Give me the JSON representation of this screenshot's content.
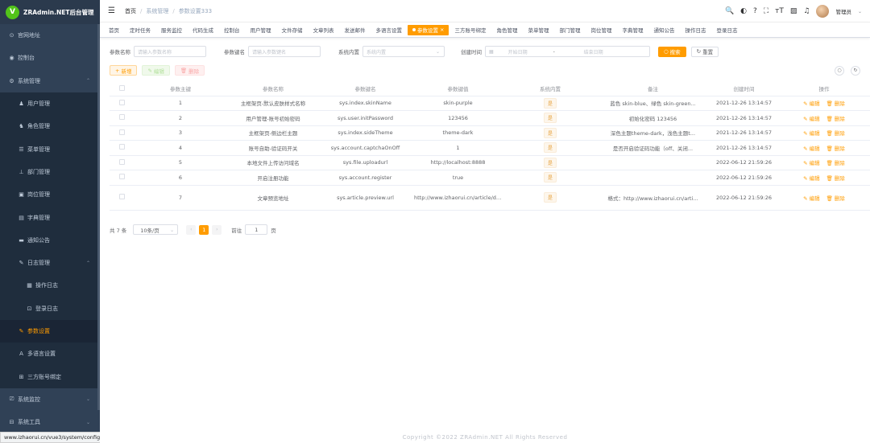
{
  "app": {
    "title": "ZRAdmin.NET后台管理",
    "logo_letter": "V"
  },
  "sidebar": {
    "items": [
      {
        "label": "官网地址",
        "icon": "link-icon",
        "glyph": "⊙",
        "level": 0
      },
      {
        "label": "控制台",
        "icon": "dashboard-icon",
        "glyph": "◉",
        "level": 0
      },
      {
        "label": "系统管理",
        "icon": "gear-icon",
        "glyph": "⚙",
        "level": 0,
        "arrow": "⌃"
      },
      {
        "label": "用户管理",
        "icon": "user-icon",
        "glyph": "♟",
        "level": 1
      },
      {
        "label": "角色管理",
        "icon": "peoples-icon",
        "glyph": "♞",
        "level": 1
      },
      {
        "label": "菜单管理",
        "icon": "menu-tree-icon",
        "glyph": "☰",
        "level": 1
      },
      {
        "label": "部门管理",
        "icon": "tree-icon",
        "glyph": "⊥",
        "level": 1
      },
      {
        "label": "岗位管理",
        "icon": "post-icon",
        "glyph": "▣",
        "level": 1
      },
      {
        "label": "字典管理",
        "icon": "dict-icon",
        "glyph": "▤",
        "level": 1
      },
      {
        "label": "通知公告",
        "icon": "message-icon",
        "glyph": "▬",
        "level": 1
      },
      {
        "label": "日志管理",
        "icon": "log-icon",
        "glyph": "✎",
        "level": 1,
        "arrow": "⌃"
      },
      {
        "label": "操作日志",
        "icon": "form-icon",
        "glyph": "▦",
        "level": 2
      },
      {
        "label": "登录日志",
        "icon": "logininfor-icon",
        "glyph": "⊡",
        "level": 2
      },
      {
        "label": "参数设置",
        "icon": "edit-icon",
        "glyph": "✎",
        "level": 1,
        "active": true
      },
      {
        "label": "多语言设置",
        "icon": "language-icon",
        "glyph": "A",
        "level": 1
      },
      {
        "label": "三方账号绑定",
        "icon": "bind-icon",
        "glyph": "⊞",
        "level": 1
      },
      {
        "label": "系统监控",
        "icon": "monitor-icon",
        "glyph": "⎚",
        "level": 0,
        "arrow": "⌄"
      },
      {
        "label": "系统工具",
        "icon": "tool-icon",
        "glyph": "⊟",
        "level": 0,
        "arrow": "⌄"
      }
    ]
  },
  "status_url": "www.izhaorui.cn/vue3/system/config",
  "breadcrumb": {
    "home": "首页",
    "parent": "系统管理",
    "current": "参数设置333"
  },
  "header": {
    "user_name": "管理员",
    "icons": [
      "search-icon",
      "github-icon",
      "question-icon",
      "fullscreen-icon",
      "font-size-icon",
      "language-icon",
      "bell-icon"
    ],
    "glyphs": [
      "🔍",
      "◐",
      "?",
      "⛶",
      "ᴛT",
      "▨",
      "♫"
    ]
  },
  "tags": [
    "首页",
    "定时任务",
    "服务监控",
    "代码生成",
    "控制台",
    "用户管理",
    "文件存储",
    "文章列表",
    "发送邮件",
    "多语言设置",
    "参数设置",
    "三方账号绑定",
    "角色管理",
    "菜单管理",
    "部门管理",
    "岗位管理",
    "字典管理",
    "通知公告",
    "操作日志",
    "登录日志"
  ],
  "active_tag": "参数设置",
  "search": {
    "name_label": "参数名称",
    "name_placeholder": "请输入参数名称",
    "key_label": "参数键名",
    "key_placeholder": "请输入参数键名",
    "builtin_label": "系统内置",
    "builtin_placeholder": "系统内置",
    "time_label": "创建时间",
    "start_placeholder": "开始日期",
    "range_sep": "-",
    "end_placeholder": "结束日期",
    "search_btn": "搜索",
    "reset_btn": "重置"
  },
  "toolbar": {
    "add": "新增",
    "edit": "编辑",
    "delete": "删除"
  },
  "table": {
    "columns": [
      "参数主键",
      "参数名称",
      "参数键名",
      "参数键值",
      "系统内置",
      "备注",
      "创建时间",
      "操作"
    ],
    "rows": [
      {
        "id": "1",
        "name": "主框架页-默认皮肤样式名称",
        "key": "sys.index.skinName",
        "value": "skin-purple",
        "builtin": "是",
        "remark": "蓝色 skin-blue、绿色 skin-green...",
        "time": "2021-12-26 13:14:57"
      },
      {
        "id": "2",
        "name": "用户管理-账号初始密码",
        "key": "sys.user.initPassword",
        "value": "123456",
        "builtin": "是",
        "remark": "初始化密码 123456",
        "time": "2021-12-26 13:14:57"
      },
      {
        "id": "3",
        "name": "主框架页-侧边栏主题",
        "key": "sys.index.sideTheme",
        "value": "theme-dark",
        "builtin": "是",
        "remark": "深色主题theme-dark，浅色主题t...",
        "time": "2021-12-26 13:14:57"
      },
      {
        "id": "4",
        "name": "账号自助-验证码开关",
        "key": "sys.account.captchaOnOff",
        "value": "1",
        "builtin": "是",
        "remark": "是否开启验证码功能（off、关闭...",
        "time": "2021-12-26 13:14:57"
      },
      {
        "id": "5",
        "name": "本地文件上传访问域名",
        "key": "sys.file.uploadurl",
        "value": "http://localhost:8888",
        "builtin": "是",
        "remark": "",
        "time": "2022-06-12 21:59:26"
      },
      {
        "id": "6",
        "name": "开启注册功能",
        "key": "sys.account.register",
        "value": "true",
        "builtin": "是",
        "remark": "",
        "time": "2022-06-12 21:59:26"
      },
      {
        "id": "7",
        "name": "文章预览地址",
        "key": "sys.article.preview.url",
        "value": "http://www.izhaorui.cn/article/details/",
        "builtin": "是",
        "remark": "格式：http://www.izhaorui.cn/arti...",
        "time": "2022-06-12 21:59:26"
      }
    ],
    "op_edit": "编辑",
    "op_delete": "删除"
  },
  "pagination": {
    "total_text": "共 7 条",
    "page_size": "10条/页",
    "current_page": "1",
    "goto_label": "前往",
    "goto_value": "1",
    "page_suffix": "页"
  },
  "footer": "Copyright ©2022 ZRAdmin.NET All Rights Reserved",
  "colors": {
    "accent": "#ff9c00",
    "sidebar_bg": "#304156"
  }
}
